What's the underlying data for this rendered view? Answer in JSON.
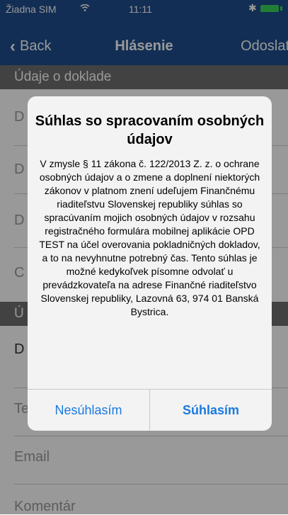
{
  "status": {
    "carrier": "Žiadna SIM",
    "time": "11:11"
  },
  "nav": {
    "back": "Back",
    "title": "Hlásenie",
    "send": "Odoslať"
  },
  "form": {
    "section1": "Údaje o doklade",
    "row1": "D",
    "row2": "D",
    "row3": "D",
    "row4": "C",
    "section2": "Ú",
    "row5": "D",
    "row6": "Te",
    "email": "Email",
    "comment": "Komentár"
  },
  "alert": {
    "title": "Súhlas so spracovaním osobných údajov",
    "message": "V zmysle § 11 zákona č. 122/2013 Z. z. o ochrane osobných údajov a o zmene a doplnení niektorých zákonov v platnom znení udeľujem Finančnému riaditeľstvu Slovenskej republiky súhlas so spracúvaním mojich osobných údajov v rozsahu registračného formulára mobilnej aplikácie OPD TEST na účel overovania pokladničných dokladov, a to na nevyhnutne potrebný čas. Tento súhlas je možné kedykoľvek písomne odvolať u prevádzkovateľa na adrese Finančné riaditeľstvo Slovenskej republiky, Lazovná 63, 974 01 Banská Bystrica.",
    "decline": "Nesúhlasím",
    "accept": "Súhlasím"
  },
  "colors": {
    "bar": "#1f4e8c",
    "accent": "#1a7ae0",
    "section": "#6e6e6e"
  }
}
